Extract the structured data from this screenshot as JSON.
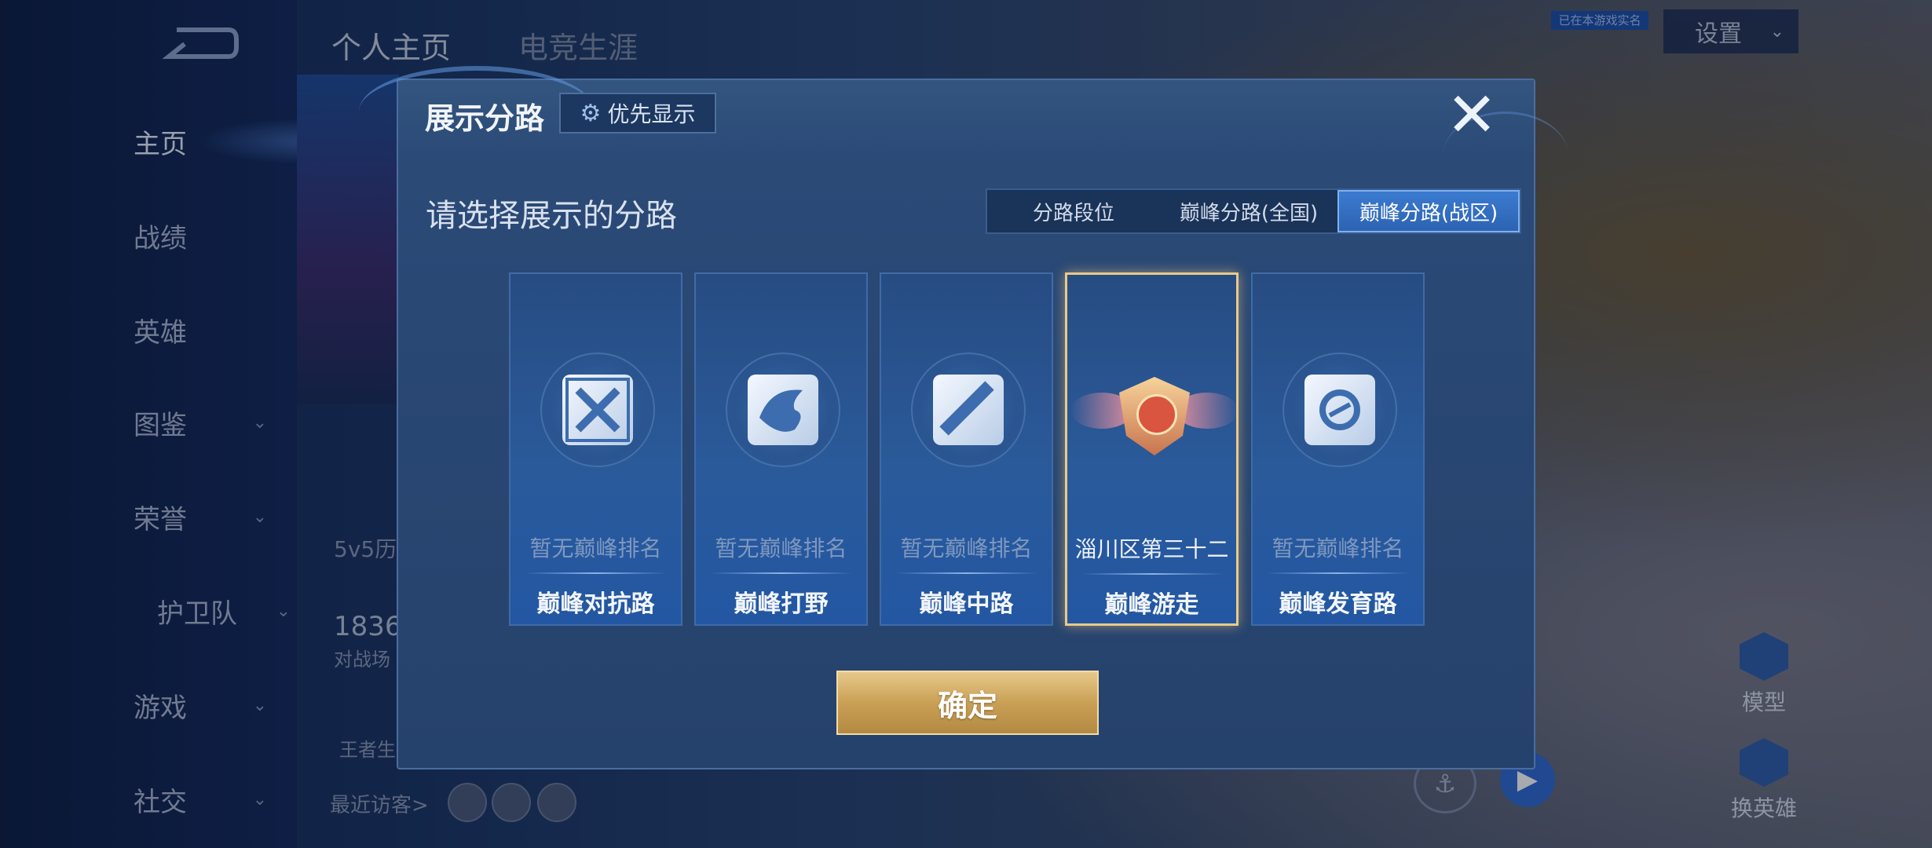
{
  "background": {
    "sidebar": [
      {
        "label": "主页",
        "has_chevron": false
      },
      {
        "label": "战绩",
        "has_chevron": false
      },
      {
        "label": "英雄",
        "has_chevron": false
      },
      {
        "label": "图鉴",
        "has_chevron": true
      },
      {
        "label": "荣誉",
        "has_chevron": true
      },
      {
        "label": "护卫队",
        "has_chevron": true
      },
      {
        "label": "游戏",
        "has_chevron": true
      },
      {
        "label": "社交",
        "has_chevron": true
      }
    ],
    "top_tabs": [
      "个人主页",
      "电竞生涯"
    ],
    "settings_label": "设置",
    "settings_badge": "已在本游戏实名",
    "peek_mode": "5v5历",
    "peek_number": "1836",
    "peek_sub": "对战场",
    "peek_wangzhe": "王者生",
    "recent_visitors": "最近访客>",
    "model_label": "模型",
    "swap_hero_label": "换英雄"
  },
  "modal": {
    "title": "展示分路",
    "priority_label": "优先显示",
    "close_label": "✕",
    "prompt": "请选择展示的分路",
    "tabs": [
      "分路段位",
      "巅峰分路(全国)",
      "巅峰分路(战区)"
    ],
    "active_tab": "巅峰分路(战区)",
    "lanes": [
      {
        "name": "巅峰对抗路",
        "rank": "暂无巅峰排名",
        "icon": "clash-lane-icon",
        "selected": false
      },
      {
        "name": "巅峰打野",
        "rank": "暂无巅峰排名",
        "icon": "jungle-dragon-icon",
        "selected": false
      },
      {
        "name": "巅峰中路",
        "rank": "暂无巅峰排名",
        "icon": "mid-lane-icon",
        "selected": false
      },
      {
        "name": "巅峰游走",
        "rank": "淄川区第三十二",
        "icon": "rank-medal-icon",
        "selected": true
      },
      {
        "name": "巅峰发育路",
        "rank": "暂无巅峰排名",
        "icon": "farm-lane-icon",
        "selected": false
      }
    ],
    "confirm_label": "确定"
  },
  "colors": {
    "modal_bg": "#2c4b78",
    "active_tab": "#3b7bd0",
    "selected_border": "#e9c98a",
    "confirm_gold": "#c9a055"
  }
}
